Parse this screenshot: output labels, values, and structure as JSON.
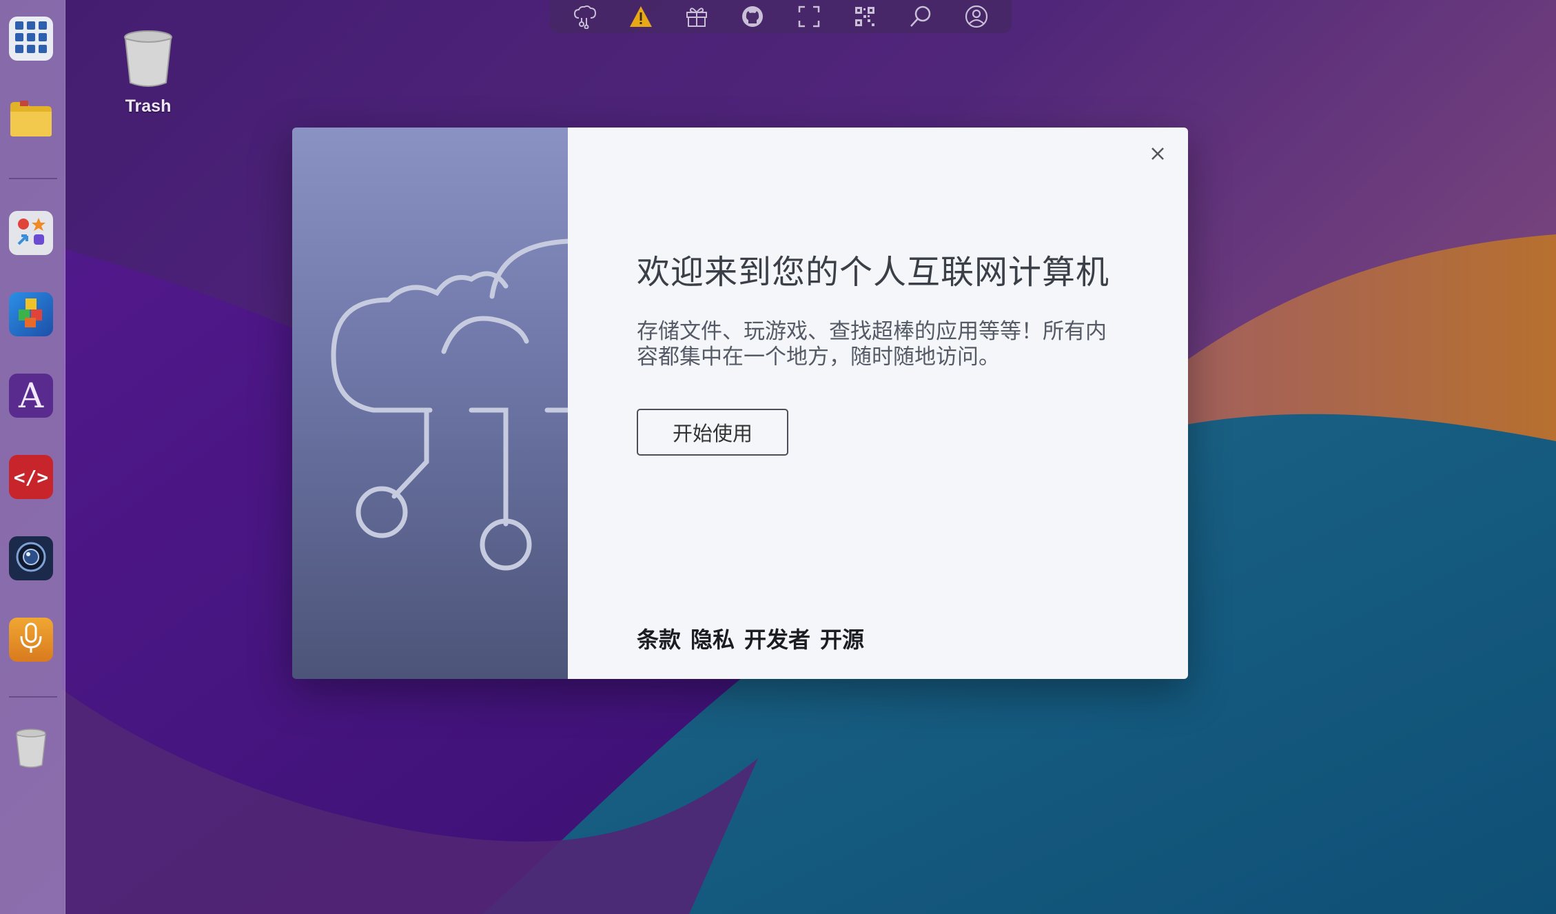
{
  "desktop": {
    "trash_label": "Trash"
  },
  "dock": {
    "items": [
      {
        "name": "app-launcher",
        "icon": "grid-icon"
      },
      {
        "name": "files",
        "icon": "folder-icon"
      },
      {
        "name": "app-center",
        "icon": "shapes-icon"
      },
      {
        "name": "game",
        "icon": "cubes-icon"
      },
      {
        "name": "font-app",
        "icon": "letter-a-icon",
        "glyph": "A"
      },
      {
        "name": "code-editor",
        "icon": "code-icon",
        "glyph": "</>"
      },
      {
        "name": "camera",
        "icon": "camera-icon"
      },
      {
        "name": "recorder",
        "icon": "microphone-icon"
      },
      {
        "name": "trash",
        "icon": "trash-icon"
      }
    ]
  },
  "taskbar": {
    "icons": [
      "cloud-network-icon",
      "warning-icon",
      "gift-icon",
      "github-icon",
      "fullscreen-icon",
      "qr-code-icon",
      "search-icon",
      "user-icon"
    ]
  },
  "modal": {
    "title": "欢迎来到您的个人互联网计算机",
    "description": "存储文件、玩游戏、查找超棒的应用等等！所有内容都集中在一个地方，随时随地访问。",
    "start_button": "开始使用",
    "links": [
      "条款",
      "隐私",
      "开发者",
      "开源"
    ]
  },
  "colors": {
    "accent_warning": "#e6a817",
    "modal_panel": "#f4f6f9",
    "illustration_left": "#6d76a6"
  }
}
